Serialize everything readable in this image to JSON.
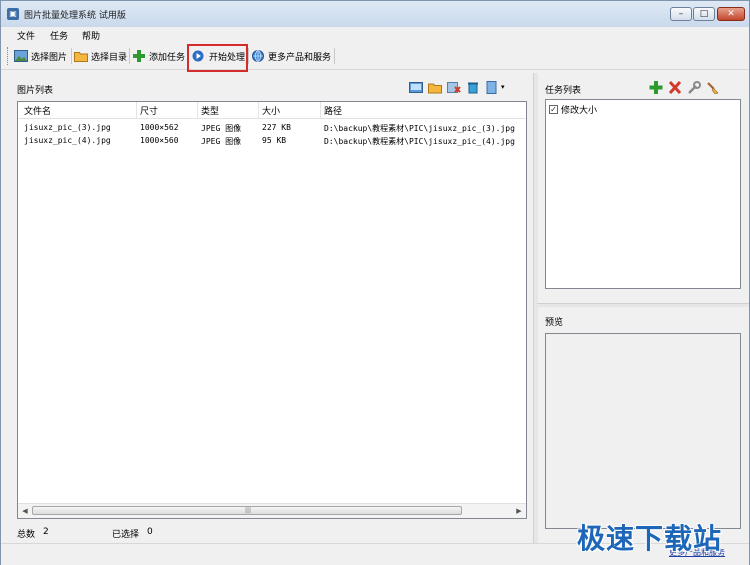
{
  "window": {
    "title": "图片批量处理系统 试用版",
    "controls": {
      "minimize": "–",
      "maximize": "□",
      "close": "✕"
    }
  },
  "menu": {
    "items": [
      "文件",
      "任务",
      "帮助"
    ]
  },
  "toolbar": {
    "items": [
      {
        "label": "选择图片",
        "icon": "image-icon"
      },
      {
        "label": "选择目录",
        "icon": "folder-icon"
      },
      {
        "label": "添加任务",
        "icon": "plus-icon"
      },
      {
        "label": "开始处理",
        "icon": "play-icon"
      },
      {
        "label": "更多产品和服务",
        "icon": "globe-icon"
      }
    ]
  },
  "image_list": {
    "title": "图片列表",
    "columns": [
      "文件名",
      "尺寸",
      "类型",
      "大小",
      "路径"
    ],
    "rows": [
      [
        "jisuxz_pic_(3).jpg",
        "1000×562",
        "JPEG 图像",
        "227 KB",
        "D:\\backup\\教程素材\\PIC\\jisuxz_pic_(3).jpg"
      ],
      [
        "jisuxz_pic_(4).jpg",
        "1000×560",
        "JPEG 图像",
        "95 KB",
        "D:\\backup\\教程素材\\PIC\\jisuxz_pic_(4).jpg"
      ]
    ]
  },
  "status": {
    "total_label": "总数",
    "total_value": "2",
    "selected_label": "已选择",
    "selected_value": "0"
  },
  "task_list": {
    "title": "任务列表",
    "items": [
      {
        "label": "修改大小",
        "checked": true
      }
    ]
  },
  "preview": {
    "title": "预览"
  },
  "bottom_link": "更多产品和服务",
  "watermark": "极速下载站",
  "colors": {
    "highlight_border": "#d42b2b",
    "accent": "#1e66b8"
  }
}
